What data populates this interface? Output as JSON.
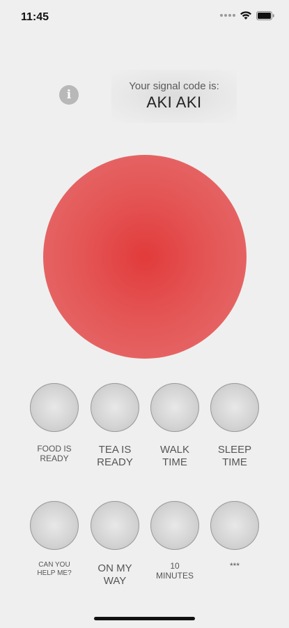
{
  "status_bar": {
    "time": "11:45",
    "icons": [
      "signal-dots-icon",
      "wifi-icon",
      "battery-icon"
    ]
  },
  "info": {
    "icon": "info-icon",
    "glyph": "i"
  },
  "signal": {
    "label": "Your signal code is:",
    "code": "AKI AKI"
  },
  "main_button": {
    "color": "#e23b3b"
  },
  "quick_messages": [
    {
      "label": "FOOD IS\nREADY"
    },
    {
      "label": "TEA IS\nREADY"
    },
    {
      "label": "WALK\nTIME"
    },
    {
      "label": "SLEEP\nTIME"
    },
    {
      "label": "CAN YOU\nHELP ME?"
    },
    {
      "label": "ON MY\nWAY"
    },
    {
      "label": "10\nMINUTES"
    },
    {
      "label": "***"
    }
  ]
}
